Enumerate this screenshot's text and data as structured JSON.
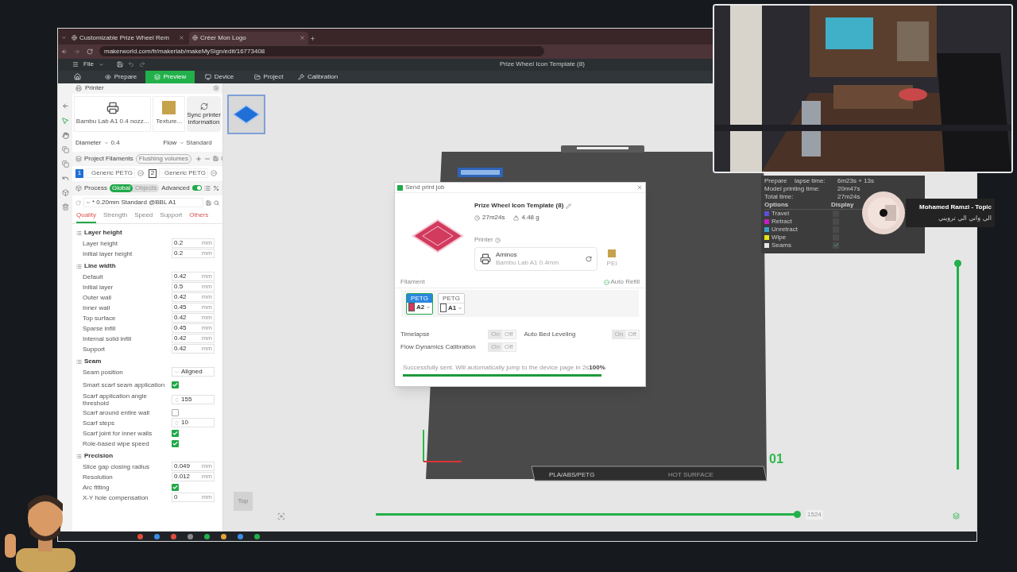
{
  "browser": {
    "tabs": [
      {
        "title": "Customizable Prize Wheel Rem",
        "selected": false
      },
      {
        "title": "Créer Mon Logo",
        "selected": true
      }
    ],
    "url": "makerworld.com/fr/makerlab/makeMySign/edit/16773408"
  },
  "app": {
    "menu": "File",
    "window_title": "Prize Wheel Icon Template (8)",
    "nav": [
      {
        "label": "Prepare",
        "selected": false
      },
      {
        "label": "Preview",
        "selected": true
      },
      {
        "label": "Device",
        "selected": false
      },
      {
        "label": "Project",
        "selected": false
      },
      {
        "label": "Calibration",
        "selected": false
      }
    ]
  },
  "sidebar": {
    "printer": {
      "title": "Printer",
      "printer_name": "Bambu Lab A1 0.4 nozz...",
      "plate": "Texture...",
      "sync": "Sync printer information",
      "diameter_label": "Diameter",
      "diameter": "0.4",
      "flow_label": "Flow",
      "flow": "Standard"
    },
    "filaments": {
      "title": "Project Filaments",
      "flushing": "Flushing volumes",
      "items": [
        {
          "index": "1",
          "name": "Generic PETG",
          "color": "#1f6fd6"
        },
        {
          "index": "2",
          "name": "Generic PETG",
          "color": "#ffffff"
        }
      ]
    },
    "process": {
      "title": "Process",
      "modes": [
        {
          "label": "Global",
          "selected": true
        },
        {
          "label": "Objects",
          "selected": false
        }
      ],
      "advanced": "Advanced",
      "advanced_on": true,
      "preset": "* 0.20mm Standard @BBL A1",
      "tabs": [
        {
          "label": "Quality",
          "selected": true,
          "modified": true
        },
        {
          "label": "Strength",
          "selected": false,
          "modified": false
        },
        {
          "label": "Speed",
          "selected": false,
          "modified": false
        },
        {
          "label": "Support",
          "selected": false,
          "modified": false
        },
        {
          "label": "Others",
          "selected": false,
          "modified": true
        }
      ]
    },
    "groups": [
      {
        "title": "Layer height",
        "rows": [
          {
            "kind": "number",
            "label": "Layer height",
            "value": "0.2",
            "unit": "mm"
          },
          {
            "kind": "number",
            "label": "Initial layer height",
            "value": "0.2",
            "unit": "mm"
          }
        ]
      },
      {
        "title": "Line width",
        "rows": [
          {
            "kind": "number",
            "label": "Default",
            "value": "0.42",
            "unit": "mm"
          },
          {
            "kind": "number",
            "label": "Initial layer",
            "value": "0.5",
            "unit": "mm"
          },
          {
            "kind": "number",
            "label": "Outer wall",
            "value": "0.42",
            "unit": "mm"
          },
          {
            "kind": "number",
            "label": "Inner wall",
            "value": "0.45",
            "unit": "mm"
          },
          {
            "kind": "number",
            "label": "Top surface",
            "value": "0.42",
            "unit": "mm"
          },
          {
            "kind": "number",
            "label": "Sparse infill",
            "value": "0.45",
            "unit": "mm"
          },
          {
            "kind": "number",
            "label": "Internal solid infill",
            "value": "0.42",
            "unit": "mm"
          },
          {
            "kind": "number",
            "label": "Support",
            "value": "0.42",
            "unit": "mm"
          }
        ]
      },
      {
        "title": "Seam",
        "rows": [
          {
            "kind": "select",
            "label": "Seam position",
            "value": "Aligned"
          },
          {
            "kind": "checkbox",
            "label": "Smart scarf seam application",
            "checked": true
          },
          {
            "kind": "spin",
            "label": "Scarf application angle threshold",
            "value": "155"
          },
          {
            "kind": "checkbox",
            "label": "Scarf around entire wall",
            "checked": false
          },
          {
            "kind": "spin",
            "label": "Scarf steps",
            "value": "10"
          },
          {
            "kind": "checkbox",
            "label": "Scarf joint for inner walls",
            "checked": true
          },
          {
            "kind": "checkbox",
            "label": "Role-based wipe speed",
            "checked": true
          }
        ]
      },
      {
        "title": "Precision",
        "rows": [
          {
            "kind": "number",
            "label": "Slice gap closing radius",
            "value": "0.049",
            "unit": "mm"
          },
          {
            "kind": "number",
            "label": "Resolution",
            "value": "0.012",
            "unit": "mm"
          },
          {
            "kind": "checkbox",
            "label": "Arc fitting",
            "checked": true
          },
          {
            "kind": "number",
            "label": "X-Y hole compensation",
            "value": "0",
            "unit": "mm"
          }
        ]
      }
    ]
  },
  "canvas": {
    "plate_number": "01",
    "bed_labels": [
      "PLA/ABS/PETG",
      "HOT SURFACE"
    ],
    "view_cube": "Top",
    "layer_slider": {
      "value": "1524",
      "level": 1
    },
    "vertical_slider": {
      "level": 1
    },
    "legend": {
      "times": [
        {
          "label": "Prepare",
          "label_tail": "lapse time:",
          "value": "6m23s + 13s"
        },
        {
          "label": "Model printing time:",
          "value": "20m47s"
        },
        {
          "label": "Total time:",
          "value": "27m24s"
        }
      ],
      "options_header": "Options",
      "display_header": "Display",
      "items": [
        {
          "label": "Travel",
          "color": "#5b4fd6",
          "checked": false
        },
        {
          "label": "Retract",
          "color": "#c21fc2",
          "checked": false
        },
        {
          "label": "Unretract",
          "color": "#3aa0c8",
          "checked": false
        },
        {
          "label": "Wipe",
          "color": "#e8e21a",
          "checked": false
        },
        {
          "label": "Seams",
          "color": "#e6e6e6",
          "checked": true
        }
      ]
    }
  },
  "dialog": {
    "title": "Send print job",
    "name": "Prize Wheel Icon Template (8)",
    "time": "27m24s",
    "weight": "4.48 g",
    "printer_label": "Printer",
    "printer_name": "Aminos",
    "printer_model": "Bambu Lab A1 0.4mm",
    "plate": "PEI",
    "filament_label": "Filament",
    "auto_refill": "Auto Refill",
    "slots": [
      {
        "type": "PETG",
        "slot": "A2",
        "color": "#d23a5e",
        "selected": true
      },
      {
        "type": "PETG",
        "slot": "A1",
        "color": "#ffffff",
        "selected": false
      }
    ],
    "options": [
      {
        "label": "Timelapse",
        "on_label": "On",
        "off_label": "Off",
        "on": false
      },
      {
        "label": "Auto Bed Leveling",
        "on_label": "On",
        "off_label": "Off",
        "on": false
      },
      {
        "label": "Flow Dynamics Calibration",
        "on_label": "On",
        "off_label": "Off",
        "on": false
      }
    ],
    "status": "Successfully sent. Will automatically jump to the device page in 2s",
    "percent": "100%",
    "level": 1
  },
  "music": {
    "artist": "Mohamed Ramzi - Topic",
    "title": "الي واني الي ترويني"
  }
}
